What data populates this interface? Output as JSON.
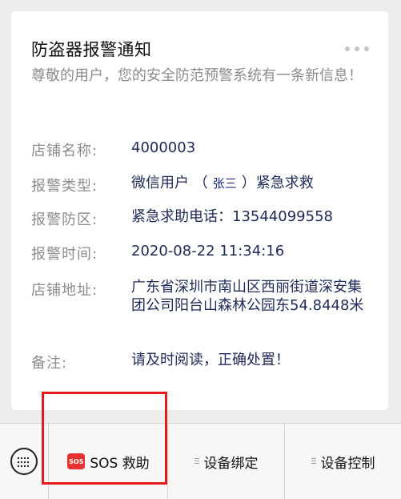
{
  "card": {
    "title": "防盗器报警通知",
    "more_icon": "more-dots-icon",
    "intro": "尊敬的用户，您的安全防范预警系统有一条新信息！",
    "fields": [
      {
        "label": "店铺名称:",
        "value": "4000003"
      },
      {
        "label": "报警类型:",
        "value_prefix": "微信用户 （",
        "value_name": "张三",
        "value_suffix": "）紧急求救"
      },
      {
        "label": "报警防区:",
        "value": "紧急求助电话：13544099558"
      },
      {
        "label": "报警时间:",
        "value": "2020-08-22 11:34:16"
      },
      {
        "label": "店铺地址:",
        "value": "广东省深圳市南山区西丽街道深安集团公司阳台山森林公园东54.8448米"
      },
      {
        "label": "备注:",
        "value": "请及时阅读，正确处置！"
      }
    ]
  },
  "bottom_menu": {
    "keyboard_icon": "keyboard-icon",
    "sos_icon_text": "SOS",
    "sos_label": "SOS 救助",
    "bind_label": "设备绑定",
    "control_label": "设备控制"
  },
  "colors": {
    "highlight": "#e8191a",
    "sos_icon": "#e8322f",
    "value_text": "#1e2a5a"
  }
}
